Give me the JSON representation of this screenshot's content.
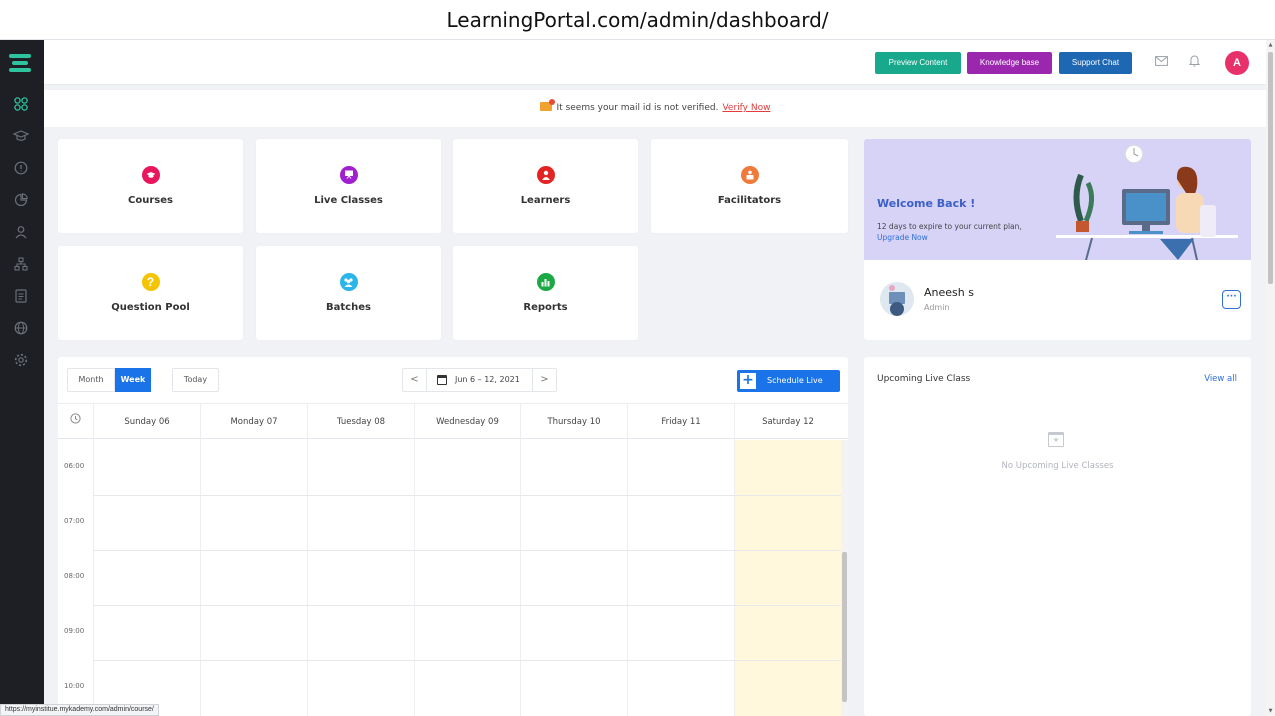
{
  "browser": {
    "url": "LearningPortal.com/admin/dashboard/"
  },
  "sidebar": {
    "icons": [
      "logo-icon",
      "dashboard-icon",
      "courses-icon",
      "question-icon",
      "reports-icon",
      "learners-icon",
      "network-icon",
      "document-icon",
      "globe-icon",
      "settings-icon"
    ],
    "active_color": "#2ec4a0"
  },
  "topbar": {
    "preview": "Preview Content",
    "knowledge": "Knowledge base",
    "support": "Support Chat",
    "avatar_letter": "A",
    "colors": {
      "preview": "#18a98d",
      "knowledge": "#9b27af",
      "support": "#1e67b3",
      "avatar": "#e8306b"
    }
  },
  "notice": {
    "text": "It seems your mail id is not verified.",
    "link": "Verify Now"
  },
  "tiles": {
    "courses": "Courses",
    "live_classes": "Live Classes",
    "learners": "Learners",
    "facilitators": "Facilitators",
    "question_pool": "Question Pool",
    "batches": "Batches",
    "reports": "Reports",
    "question_icon_glyph": "?"
  },
  "welcome": {
    "title": "Welcome Back !",
    "subtitle": "12 days to expire to your current plan,",
    "upgrade": "Upgrade Now"
  },
  "profile": {
    "name": "Aneesh s",
    "role": "Admin",
    "more": "···"
  },
  "calendar": {
    "views": {
      "month": "Month",
      "week": "Week",
      "today": "Today"
    },
    "range": "Jun 6 – 12, 2021",
    "prev": "<",
    "next": ">",
    "schedule": "Schedule Live",
    "schedule_plus": "+",
    "days": [
      "Sunday 06",
      "Monday 07",
      "Tuesday 08",
      "Wednesday 09",
      "Thursday 10",
      "Friday 11",
      "Saturday 12"
    ],
    "times": [
      "06:00",
      "07:00",
      "08:00",
      "09:00",
      "10:00"
    ],
    "highlight_color": "#fff8dc"
  },
  "upcoming": {
    "title": "Upcoming Live Class",
    "view_all": "View all",
    "empty": "No Upcoming Live Classes"
  },
  "status_url": "https://myinstitue.mykademy.com/admin/course/"
}
